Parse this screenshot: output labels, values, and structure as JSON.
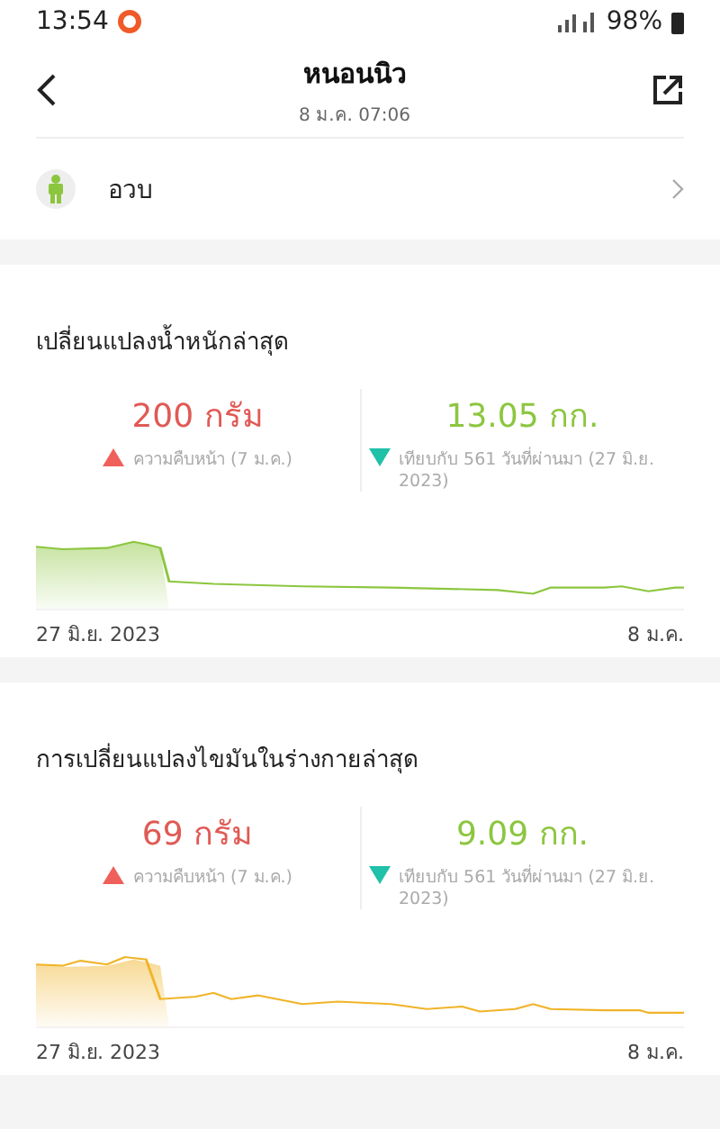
{
  "status_bar": {
    "time": "13:54",
    "battery": "98%"
  },
  "header": {
    "title": "หนอนนิว",
    "subtitle": "8 ม.ค. 07:06"
  },
  "body_type": {
    "label": "อวบ"
  },
  "cards": [
    {
      "title": "เปลี่ยนแปลงน้ำหนักล่าสุด",
      "color": "#8cc63f",
      "stats": [
        {
          "value": "200",
          "unit": "กรัม",
          "increase": true,
          "note": "ความคืบหน้า (7 ม.ค.)"
        },
        {
          "value": "13.05",
          "unit": "กก.",
          "increase": false,
          "note": "เทียบกับ 561 วันที่ผ่านมา (27 มิ.ย. 2023)"
        }
      ],
      "start_label": "27 มิ.ย. 2023",
      "end_label": "8 ม.ค."
    },
    {
      "title": "การเปลี่ยนแปลงไขมันในร่างกายล่าสุด",
      "color": "#f0b429",
      "stats": [
        {
          "value": "69",
          "unit": "กรัม",
          "increase": true,
          "note": "ความคืบหน้า (7 ม.ค.)"
        },
        {
          "value": "9.09",
          "unit": "กก.",
          "increase": false,
          "note": "เทียบกับ 561 วันที่ผ่านมา (27 มิ.ย. 2023)"
        }
      ],
      "start_label": "27 มิ.ย. 2023",
      "end_label": "8 ม.ค."
    }
  ]
}
